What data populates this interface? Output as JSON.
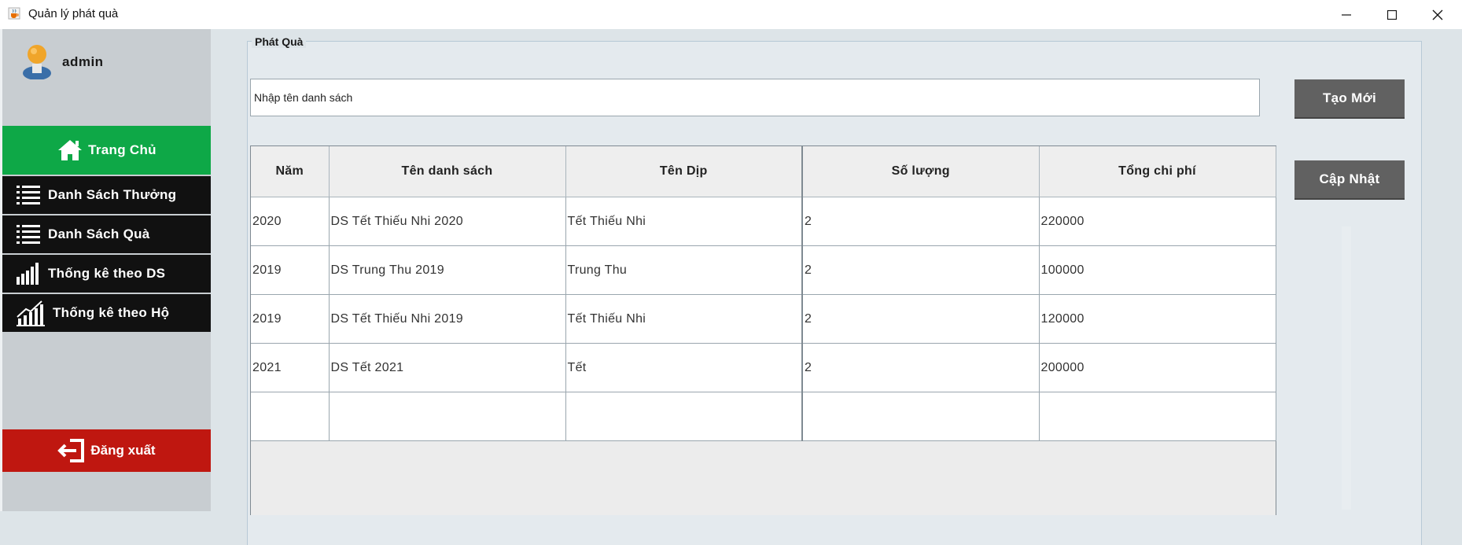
{
  "window": {
    "title": "Quản lý phát quà",
    "app_icon": "java-cup-icon"
  },
  "sidebar": {
    "username": "admin",
    "items": [
      {
        "label": "Trang Chủ",
        "icon": "home-icon",
        "active": true,
        "color": "#0ea847"
      },
      {
        "label": "Danh Sách Thưởng",
        "icon": "list-icon"
      },
      {
        "label": "Danh Sách Quà",
        "icon": "list-icon"
      },
      {
        "label": "Thống kê theo DS",
        "icon": "bar-chart-icon"
      },
      {
        "label": "Thống kê theo Hộ",
        "icon": "growth-chart-icon"
      }
    ],
    "logout": {
      "label": "Đăng xuất",
      "icon": "logout-icon",
      "color": "#bf1710"
    }
  },
  "main": {
    "group_title": "Phát Quà",
    "name_input": {
      "value": "Nhập tên danh sách"
    },
    "buttons": {
      "create": "Tạo Mới",
      "update": "Cập Nhật"
    },
    "table": {
      "columns": [
        "Năm",
        "Tên danh sách",
        "Tên Dịp",
        "Số lượng",
        "Tổng chi phí"
      ],
      "rows": [
        [
          "2020",
          "DS Tết Thiếu Nhi 2020",
          "Tết Thiếu Nhi",
          "2",
          "220000"
        ],
        [
          "2019",
          "DS Trung Thu 2019",
          "Trung Thu",
          "2",
          "100000"
        ],
        [
          "2019",
          "DS Tết Thiếu Nhi 2019",
          "Tết Thiếu Nhi",
          "2",
          "120000"
        ],
        [
          "2021",
          "DS Tết 2021",
          "Tết",
          "2",
          "200000"
        ],
        [
          "",
          "",
          "",
          "",
          ""
        ]
      ]
    }
  }
}
